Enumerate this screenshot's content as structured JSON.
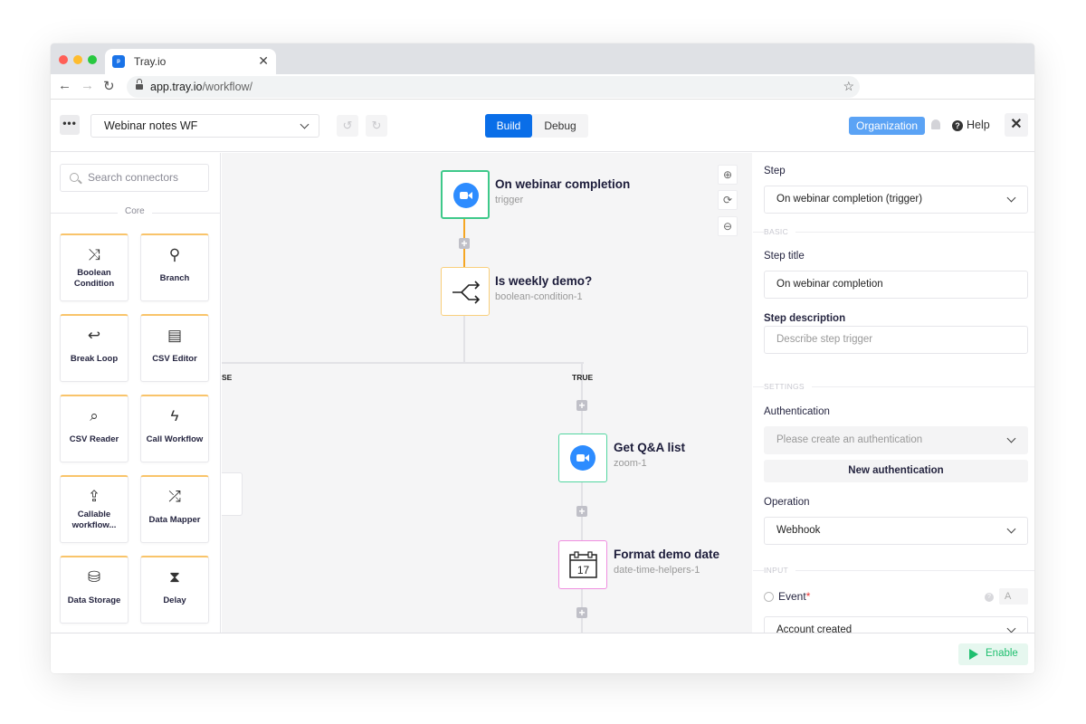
{
  "browser": {
    "tab_title": "Tray.io",
    "tab_favicon": "tray-logo",
    "url_host": "app.tray.io",
    "url_path": "/workflow/",
    "traffic_lights": {
      "close": "#ff5f57",
      "minimize": "#febc2e",
      "maximize": "#28c840"
    }
  },
  "header": {
    "more_label": "•••",
    "workflow_name": "Webinar notes WF",
    "undo_icon": "↺",
    "redo_icon": "↻",
    "modes": [
      {
        "label": "Build",
        "active": true
      },
      {
        "label": "Debug",
        "active": false
      }
    ],
    "organization_label": "Organization",
    "help_label": "Help",
    "help_icon": "?",
    "close_icon": "✕"
  },
  "sidebar": {
    "search_placeholder": "Search connectors",
    "section_label": "Core",
    "connectors": [
      {
        "label": "Boolean Condition",
        "icon": "⤨"
      },
      {
        "label": "Branch",
        "icon": "⚲"
      },
      {
        "label": "Break Loop",
        "icon": "↩"
      },
      {
        "label": "CSV Editor",
        "icon": "▤"
      },
      {
        "label": "CSV Reader",
        "icon": "⌕"
      },
      {
        "label": "Call Workflow",
        "icon": "ϟ"
      },
      {
        "label": "Callable workflow...",
        "icon": "⇪"
      },
      {
        "label": "Data Mapper",
        "icon": "⤮"
      },
      {
        "label": "Data Storage",
        "icon": "⛁"
      },
      {
        "label": "Delay",
        "icon": "⧗"
      }
    ]
  },
  "canvas": {
    "zoom_controls": {
      "zoom_in": "⊕",
      "reset": "⟳",
      "zoom_out": "⊖"
    },
    "steps": [
      {
        "title": "On webinar completion",
        "subtitle": "trigger",
        "type": "zoom"
      },
      {
        "title": "Is weekly demo?",
        "subtitle": "boolean-condition-1",
        "type": "boolean"
      },
      {
        "title": "Get Q&A list",
        "subtitle": "zoom-1",
        "type": "zoom"
      },
      {
        "title": "Format demo date",
        "subtitle": "date-time-helpers-1",
        "type": "date",
        "calendar_day": "17"
      }
    ],
    "branch_labels": {
      "false": "SE",
      "true": "TRUE"
    },
    "add_step_icon": "+"
  },
  "panel": {
    "step_label": "Step",
    "step_value": "On webinar completion (trigger)",
    "basic_section": "BASIC",
    "step_title_label": "Step title",
    "step_title_value": "On webinar completion",
    "step_description_label": "Step description",
    "step_description_placeholder": "Describe step trigger",
    "settings_section": "SETTINGS",
    "authentication_label": "Authentication",
    "authentication_placeholder": "Please create an authentication",
    "new_auth_label": "New authentication",
    "operation_label": "Operation",
    "operation_value": "Webhook",
    "input_section": "INPUT",
    "event_label": "Event",
    "event_required": "*",
    "event_type": "A",
    "event_value": "Account created"
  },
  "footer": {
    "enable_label": "Enable"
  }
}
